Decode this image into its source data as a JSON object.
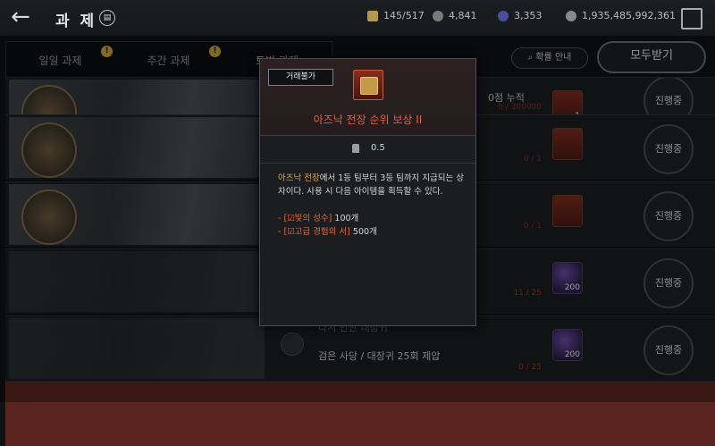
{
  "header": {
    "title": "과 제",
    "book_icon": "book-icon",
    "resources": [
      {
        "name": "currency-1",
        "value": "145/517",
        "color": "#b29a4a"
      },
      {
        "name": "currency-2",
        "value": "4,841",
        "color": "#7a7a7a"
      },
      {
        "name": "currency-3",
        "value": "3,353",
        "color": "#4a4f9a"
      },
      {
        "name": "currency-4",
        "value": "1,935,485,992,361",
        "color": "#8a8a8a"
      }
    ]
  },
  "tabs": [
    {
      "label": "일일 과제",
      "badge": "!"
    },
    {
      "label": "주간 과제",
      "badge": "!"
    },
    {
      "label": "토벌 과제",
      "badge": ""
    }
  ],
  "toolbar": {
    "help_label": "확률 안내",
    "claim_all_label": "모두받기"
  },
  "rows": [
    {
      "title": "",
      "desc": "",
      "progress": "0 / 300000",
      "reward_qty": "1",
      "status": "진행중",
      "reward_type": "box"
    },
    {
      "title": "",
      "desc": "",
      "progress": "0 / 1",
      "reward_qty": "",
      "status": "진행중",
      "reward_type": "box"
    },
    {
      "title": "",
      "desc": "",
      "progress": "0 / 1",
      "reward_qty": "",
      "status": "진행중",
      "reward_type": "box"
    },
    {
      "title": "",
      "desc": "",
      "progress": "11 / 25",
      "reward_qty": "200",
      "status": "진행중",
      "reward_type": "orb"
    },
    {
      "title": "다시 만난 대장귀",
      "desc": "검은 사당 / 대장귀 25회 제압",
      "progress": "0 / 25",
      "reward_qty": "200",
      "status": "진행중",
      "reward_type": "orb"
    }
  ],
  "partial_row_text": "0점 누적",
  "tooltip": {
    "badge": "거래불가",
    "item_name": "아즈낙 전장 순위 보상 II",
    "weight": "0.5",
    "desc_prefix": "아즈낙 전장",
    "desc_text": "에서 1등 팀부터 3등 팀까지 지급되는 상자이다. 사용 시 다음 아이템을 획득할 수 있다.",
    "items": [
      {
        "bullet": "- ",
        "name": "[☑빛의 성수]",
        "qty": " 100개"
      },
      {
        "bullet": "- ",
        "name": "[☑고급 경험의 서]",
        "qty": " 500개"
      }
    ]
  }
}
